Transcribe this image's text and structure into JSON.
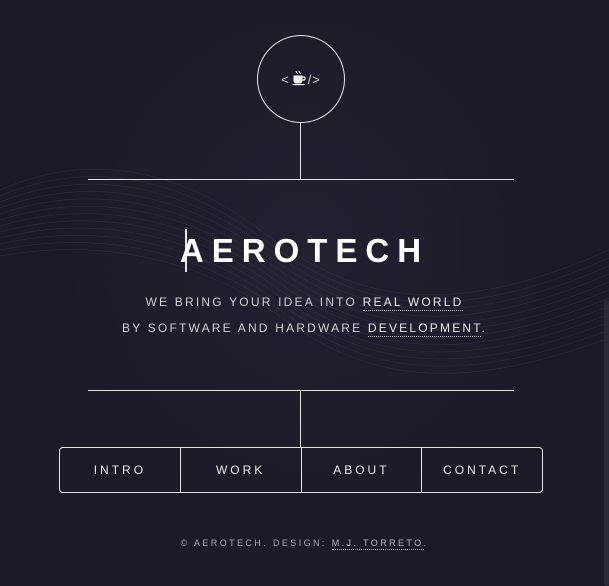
{
  "header": {
    "logo": {
      "open": "<",
      "icon": "coffee-cup-icon",
      "close": "/>"
    }
  },
  "main": {
    "title": "AEROTECH",
    "tagline": {
      "line1_prefix": "WE BRING YOUR IDEA INTO ",
      "line1_highlight": "REAL WORLD",
      "line2_prefix": "BY SOFTWARE AND HARDWARE ",
      "line2_highlight": "DEVELOPMENT",
      "line2_suffix": "."
    }
  },
  "nav": {
    "items": [
      {
        "label": "INTRO"
      },
      {
        "label": "WORK"
      },
      {
        "label": "ABOUT"
      },
      {
        "label": "CONTACT"
      }
    ]
  },
  "footer": {
    "prefix": "© AEROTECH. DESIGN: ",
    "credit": "M.J. TORRETO",
    "suffix": "."
  },
  "colors": {
    "background": "#1b1a26",
    "line": "#e2e2e6",
    "text": "#ffffff"
  }
}
